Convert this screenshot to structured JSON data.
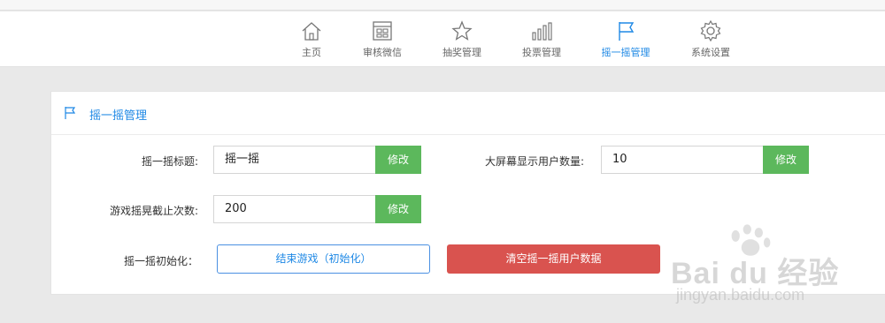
{
  "nav": {
    "items": [
      {
        "label": "主页",
        "icon": "home-icon"
      },
      {
        "label": "审核微信",
        "icon": "review-icon"
      },
      {
        "label": "抽奖管理",
        "icon": "star-icon"
      },
      {
        "label": "投票管理",
        "icon": "bar-chart-icon"
      },
      {
        "label": "摇一摇管理",
        "icon": "flag-icon",
        "active": true
      },
      {
        "label": "系统设置",
        "icon": "gear-icon"
      }
    ]
  },
  "panel": {
    "title": "摇一摇管理",
    "shake_title_label": "摇一摇标题:",
    "shake_title_value": "摇一摇",
    "screen_users_label": "大屏幕显示用户数量:",
    "screen_users_value": "10",
    "shake_count_label": "游戏摇晃截止次数:",
    "shake_count_value": "200",
    "edit_label": "修改",
    "init_label": "摇一摇初始化：",
    "end_game_label": "结束游戏（初始化）",
    "clear_users_label": "清空摇一摇用户数据"
  },
  "colors": {
    "accent": "#1e88e5",
    "success": "#5cb85c",
    "danger": "#d9534f"
  },
  "watermark": {
    "brand": "Bai du 经验",
    "url": "jingyan.baidu.com"
  }
}
